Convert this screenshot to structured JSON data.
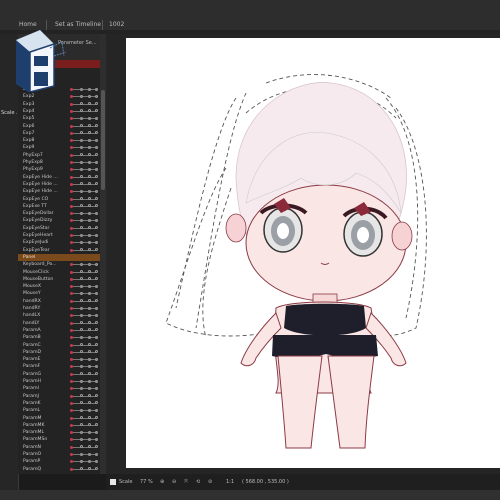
{
  "topbar": {
    "tabs": [
      "Home",
      "Set as Timeline",
      "1002"
    ]
  },
  "leftstrip": {
    "label": "Scale ..."
  },
  "panel": {
    "title": "Parameter Se...",
    "rows": [
      {
        "label": "Exp1",
        "group": false
      },
      {
        "label": "Exp2",
        "group": false
      },
      {
        "label": "Exp3",
        "group": false
      },
      {
        "label": "Exp4",
        "group": false
      },
      {
        "label": "Exp5",
        "group": false
      },
      {
        "label": "Exp6",
        "group": false
      },
      {
        "label": "Exp7",
        "group": false
      },
      {
        "label": "Exp8",
        "group": false
      },
      {
        "label": "Exp9",
        "group": false
      },
      {
        "label": "PhyExp7",
        "group": false
      },
      {
        "label": "PhyExp8",
        "group": false
      },
      {
        "label": "PhyExp9",
        "group": false
      },
      {
        "label": "ExpEye Hide ...",
        "group": false
      },
      {
        "label": "ExpEye Hide ...",
        "group": false
      },
      {
        "label": "ExpEye Hide ...",
        "group": false
      },
      {
        "label": "ExpEye CO",
        "group": false
      },
      {
        "label": "ExpExe TT",
        "group": false
      },
      {
        "label": "ExpEyeDollar",
        "group": false
      },
      {
        "label": "ExpEyeDizzy",
        "group": false
      },
      {
        "label": "ExpEyeStar",
        "group": false
      },
      {
        "label": "ExpEyeHeart",
        "group": false
      },
      {
        "label": "ExpEyeJudi",
        "group": false
      },
      {
        "label": "ExpEyeTear",
        "group": false
      },
      {
        "label": "Panel",
        "group": true
      },
      {
        "label": "Keyboard_Po...",
        "group": false
      },
      {
        "label": "MouseClick",
        "group": false
      },
      {
        "label": "MouseButton",
        "group": false
      },
      {
        "label": "MouseX",
        "group": false
      },
      {
        "label": "MouseY",
        "group": false
      },
      {
        "label": "handRX",
        "group": false
      },
      {
        "label": "handRY",
        "group": false
      },
      {
        "label": "handLX",
        "group": false
      },
      {
        "label": "handLY",
        "group": false
      },
      {
        "label": "ParamA",
        "group": false
      },
      {
        "label": "ParamB",
        "group": false
      },
      {
        "label": "ParamC",
        "group": false
      },
      {
        "label": "ParamD",
        "group": false
      },
      {
        "label": "ParamE",
        "group": false
      },
      {
        "label": "ParamF",
        "group": false
      },
      {
        "label": "ParamG",
        "group": false
      },
      {
        "label": "ParamH",
        "group": false
      },
      {
        "label": "ParamI",
        "group": false
      },
      {
        "label": "ParamJ",
        "group": false
      },
      {
        "label": "ParamK",
        "group": false
      },
      {
        "label": "ParamL",
        "group": false
      },
      {
        "label": "ParamM",
        "group": false
      },
      {
        "label": "ParamMK",
        "group": false
      },
      {
        "label": "ParamML",
        "group": false
      },
      {
        "label": "ParamMSn",
        "group": false
      },
      {
        "label": "ParamN",
        "group": false
      },
      {
        "label": "ParamO",
        "group": false
      },
      {
        "label": "ParamP",
        "group": false
      },
      {
        "label": "ParamQ",
        "group": false
      }
    ]
  },
  "status": {
    "scale_label": "Scale",
    "zoom": "77 %",
    "ratio": "1:1",
    "coords": "( 568.00 , 535.00 )"
  },
  "colors": {
    "accent_red": "#c9384a",
    "group_row": "#7a4a1c",
    "canvas": "#ffffff"
  },
  "icons": [
    "save-icon",
    "zoom-in-icon",
    "zoom-out-icon",
    "fit-icon",
    "rotate-icon",
    "link-icon"
  ]
}
